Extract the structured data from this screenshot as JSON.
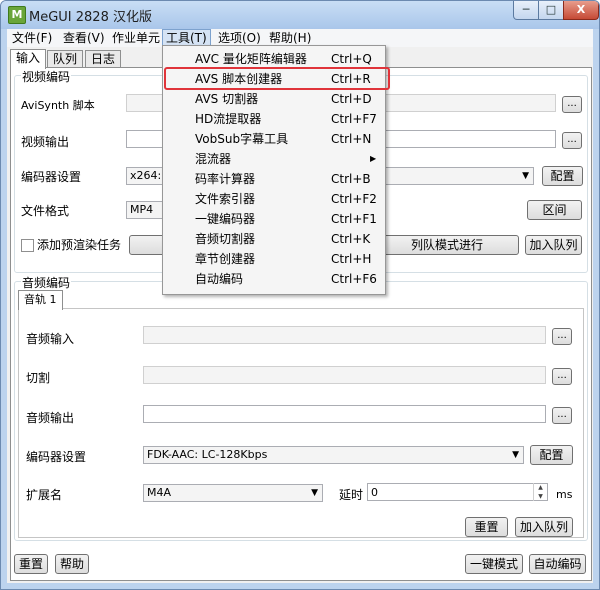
{
  "window": {
    "title": "MeGUI 2828 汉化版",
    "icon": "megui-app-icon"
  },
  "caption_buttons": {
    "minimize": "─",
    "maximize": "□",
    "close": "X"
  },
  "menubar": [
    "文件(F)",
    "查看(V)",
    "作业单元",
    "工具(T)",
    "选项(O)",
    "帮助(H)"
  ],
  "top_tabs": [
    "输入",
    "队列",
    "日志"
  ],
  "video": {
    "group_label": "视频编码",
    "avisynth_label": "AviSynth 脚本",
    "output_label": "视频输出",
    "encoder_label": "编码器设置",
    "encoder_value": "x264: *",
    "config_button": "配置",
    "format_label": "文件格式",
    "format_value": "MP4",
    "section_button": "区间",
    "prerender_label": "添加预渲染任务",
    "queue_mode_button": "列队模式进行",
    "add_queue_button": "加入队列",
    "dots": "..."
  },
  "audio": {
    "group_label": "音频编码",
    "track_tab": "音轨 1",
    "input_label": "音频输入",
    "cut_label": "切割",
    "output_label": "音频输出",
    "encoder_label": "编码器设置",
    "encoder_value": "FDK-AAC: LC-128Kbps",
    "config_button": "配置",
    "ext_label": "扩展名",
    "ext_value": "M4A",
    "delay_label": "延时",
    "delay_value": "0",
    "delay_unit": "ms",
    "reset_button": "重置",
    "add_queue_button": "加入队列",
    "dots": "..."
  },
  "bottom": {
    "reset": "重置",
    "help": "帮助",
    "oneclick": "一键模式",
    "autoencode": "自动编码"
  },
  "tools_menu": [
    {
      "label": "AVC 量化矩阵编辑器",
      "shortcut": "Ctrl+Q"
    },
    {
      "label": "AVS 脚本创建器",
      "shortcut": "Ctrl+R"
    },
    {
      "label": "AVS 切割器",
      "shortcut": "Ctrl+D"
    },
    {
      "label": "HD流提取器",
      "shortcut": "Ctrl+F7"
    },
    {
      "label": "VobSub字幕工具",
      "shortcut": "Ctrl+N"
    },
    {
      "label": "混流器",
      "shortcut": "",
      "submenu": "▶"
    },
    {
      "label": "码率计算器",
      "shortcut": "Ctrl+B"
    },
    {
      "label": "文件索引器",
      "shortcut": "Ctrl+F2"
    },
    {
      "label": "一键编码器",
      "shortcut": "Ctrl+F1"
    },
    {
      "label": "音频切割器",
      "shortcut": "Ctrl+K"
    },
    {
      "label": "章节创建器",
      "shortcut": "Ctrl+H"
    },
    {
      "label": "自动编码",
      "shortcut": "Ctrl+F6"
    }
  ],
  "colors": {
    "highlight_box": "#e0343a",
    "titlebar": "#bcd3ee"
  }
}
